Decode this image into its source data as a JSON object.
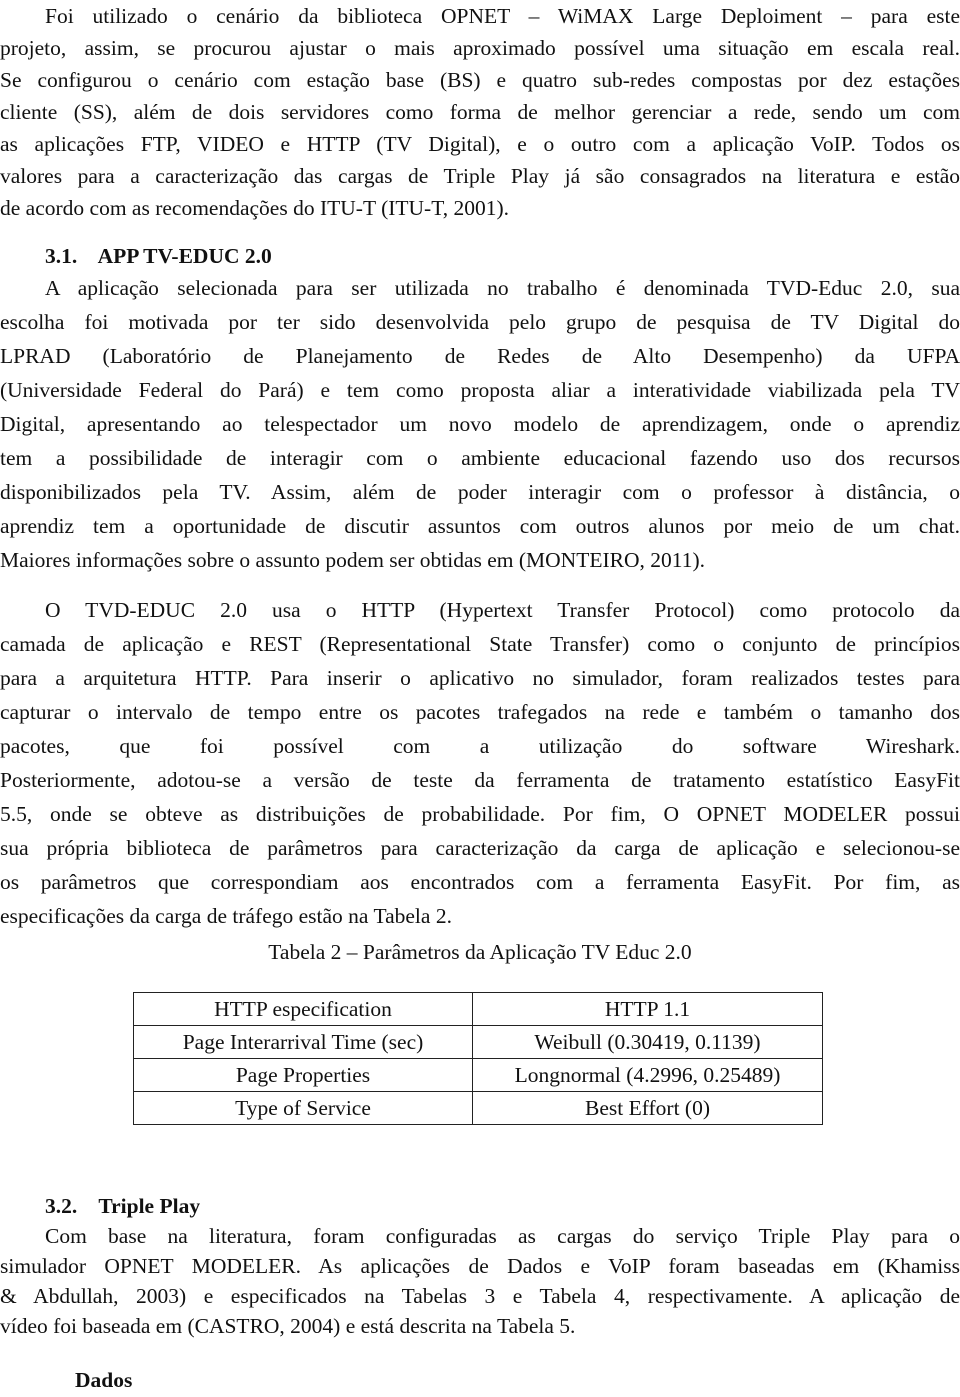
{
  "document": {
    "intro_paragraph": [
      "Foi utilizado o cenário da biblioteca OPNET – WiMAX Large Deploiment – para este",
      "projeto, assim, se procurou ajustar o mais aproximado possível uma situação em escala real.",
      "Se configurou o cenário com estação base (BS) e quatro sub-redes compostas por dez estações",
      "cliente (SS), além de dois servidores como forma de melhor gerenciar a rede, sendo um com",
      "as aplicações FTP, VIDEO e HTTP (TV Digital), e o outro com a aplicação VoIP. Todos os",
      "valores para a caracterização das cargas de Triple Play já são consagrados na literatura e estão",
      "de acordo com as recomendações do ITU-T (ITU-T, 2001)."
    ],
    "section_3_1": {
      "heading": "3.1.    APP TV-EDUC 2.0",
      "paragraph_1": [
        "A aplicação selecionada para ser utilizada no trabalho é denominada TVD-Educ 2.0, sua",
        "escolha foi motivada por ter sido desenvolvida pelo grupo de pesquisa de TV Digital do",
        "LPRAD (Laboratório de Planejamento de Redes de Alto Desempenho) da UFPA",
        "(Universidade Federal do Pará) e tem como proposta aliar a interatividade viabilizada pela TV",
        "Digital, apresentando ao telespectador um novo modelo de aprendizagem, onde o aprendiz",
        "tem a possibilidade de interagir com o ambiente educacional fazendo uso dos recursos",
        "disponibilizados pela TV. Assim, além de poder interagir com o professor à distância, o",
        "aprendiz tem a oportunidade de discutir assuntos com outros alunos por meio de um chat.",
        "Maiores informações sobre o assunto podem ser obtidas em (MONTEIRO, 2011)."
      ],
      "paragraph_2": [
        "O TVD-EDUC 2.0 usa o HTTP (Hypertext Transfer Protocol) como protocolo da",
        "camada de aplicação e REST (Representational State Transfer) como o conjunto de princípios",
        "para a arquitetura HTTP. Para inserir o aplicativo no simulador, foram realizados testes para",
        "capturar o intervalo de tempo entre os pacotes trafegados na rede e também o tamanho dos",
        "pacotes, que foi possível com a utilização do software Wireshark.",
        "Posteriormente, adotou-se a versão de teste da ferramenta de tratamento estatístico EasyFit",
        "5.5, onde se obteve as distribuições de probabilidade. Por fim, O OPNET MODELER possui",
        "sua própria biblioteca de parâmetros para caracterização da carga de aplicação e selecionou-se",
        "os parâmetros que correspondiam aos encontrados com a ferramenta EasyFit. Por fim, as",
        "especificações da carga de tráfego estão na Tabela 2."
      ],
      "table_caption": "Tabela 2 – Parâmetros da Aplicação TV Educ 2.0",
      "table_rows": [
        [
          "HTTP especification",
          "HTTP 1.1"
        ],
        [
          "Page Interarrival Time (sec)",
          "Weibull (0.30419, 0.1139)"
        ],
        [
          "Page Properties",
          "Longnormal (4.2996, 0.25489)"
        ],
        [
          "Type of Service",
          "Best Effort (0)"
        ]
      ]
    },
    "section_3_2": {
      "heading": "3.2.    Triple Play",
      "paragraph": [
        "Com base na literatura, foram configuradas as cargas do serviço Triple Play para o",
        "simulador OPNET MODELER. As aplicações de Dados e VoIP foram baseadas em (Khamiss",
        "& Abdullah, 2003) e especificados na Tabelas 3 e Tabela 4, respectivamente. A aplicação de",
        "vídeo foi baseada em (CASTRO, 2004) e está descrita na Tabela 5."
      ],
      "subheading": "Dados"
    }
  }
}
